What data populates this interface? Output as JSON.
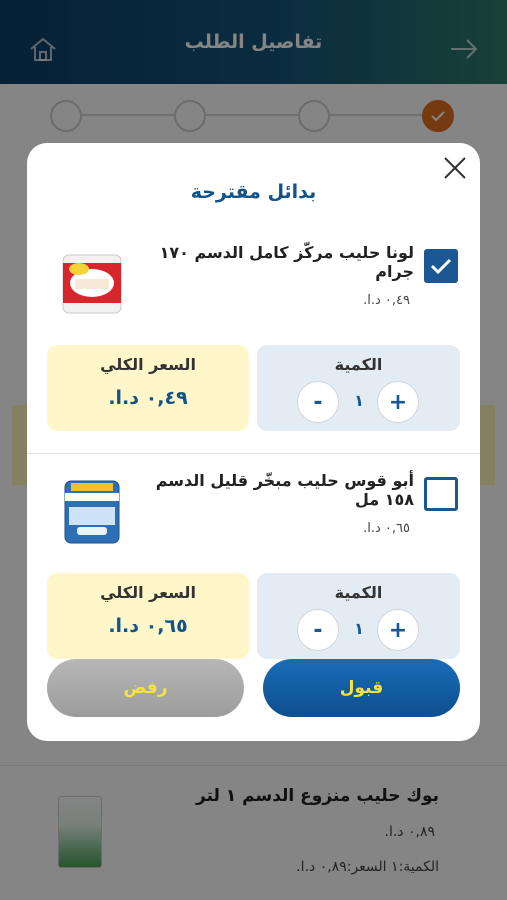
{
  "header": {
    "title": "تفاصيل الطلب",
    "home_icon": "home-icon",
    "back_icon": "arrow-right-icon"
  },
  "progress": {
    "steps_total": 4,
    "steps_done": 1
  },
  "background_product": {
    "name": "بوك حليب منزوع الدسم ١ لتر",
    "price": "٠,٨٩ د.ا.",
    "quantity_line": "الكمية:١ السعر:٠,٨٩ د.ا."
  },
  "modal": {
    "title": "بدائل مقترحة",
    "close_icon": "close-icon",
    "alternatives": [
      {
        "name": "لونا حليب مركّز كامل الدسم ١٧٠ جرام",
        "price": "٠,٤٩ د.ا.",
        "checked": true,
        "quantity_label": "الكمية",
        "quantity": "١",
        "total_label": "السعر الكلي",
        "total": "٠,٤٩ د.ا."
      },
      {
        "name": "أبو قوس حليب مبخّر قليل الدسم ١٥٨ مل",
        "price": "٠,٦٥ د.ا.",
        "checked": false,
        "quantity_label": "الكمية",
        "quantity": "١",
        "total_label": "السعر الكلي",
        "total": "٠,٦٥ د.ا."
      }
    ],
    "plus": "+",
    "minus": "-",
    "accept_label": "قبول",
    "reject_label": "رفض"
  },
  "colors": {
    "primary": "#1a5793",
    "accent_orange": "#e37020",
    "total_bg": "#fff7c9",
    "qty_bg": "#e3ebf3",
    "button_text": "#f5e43a"
  }
}
